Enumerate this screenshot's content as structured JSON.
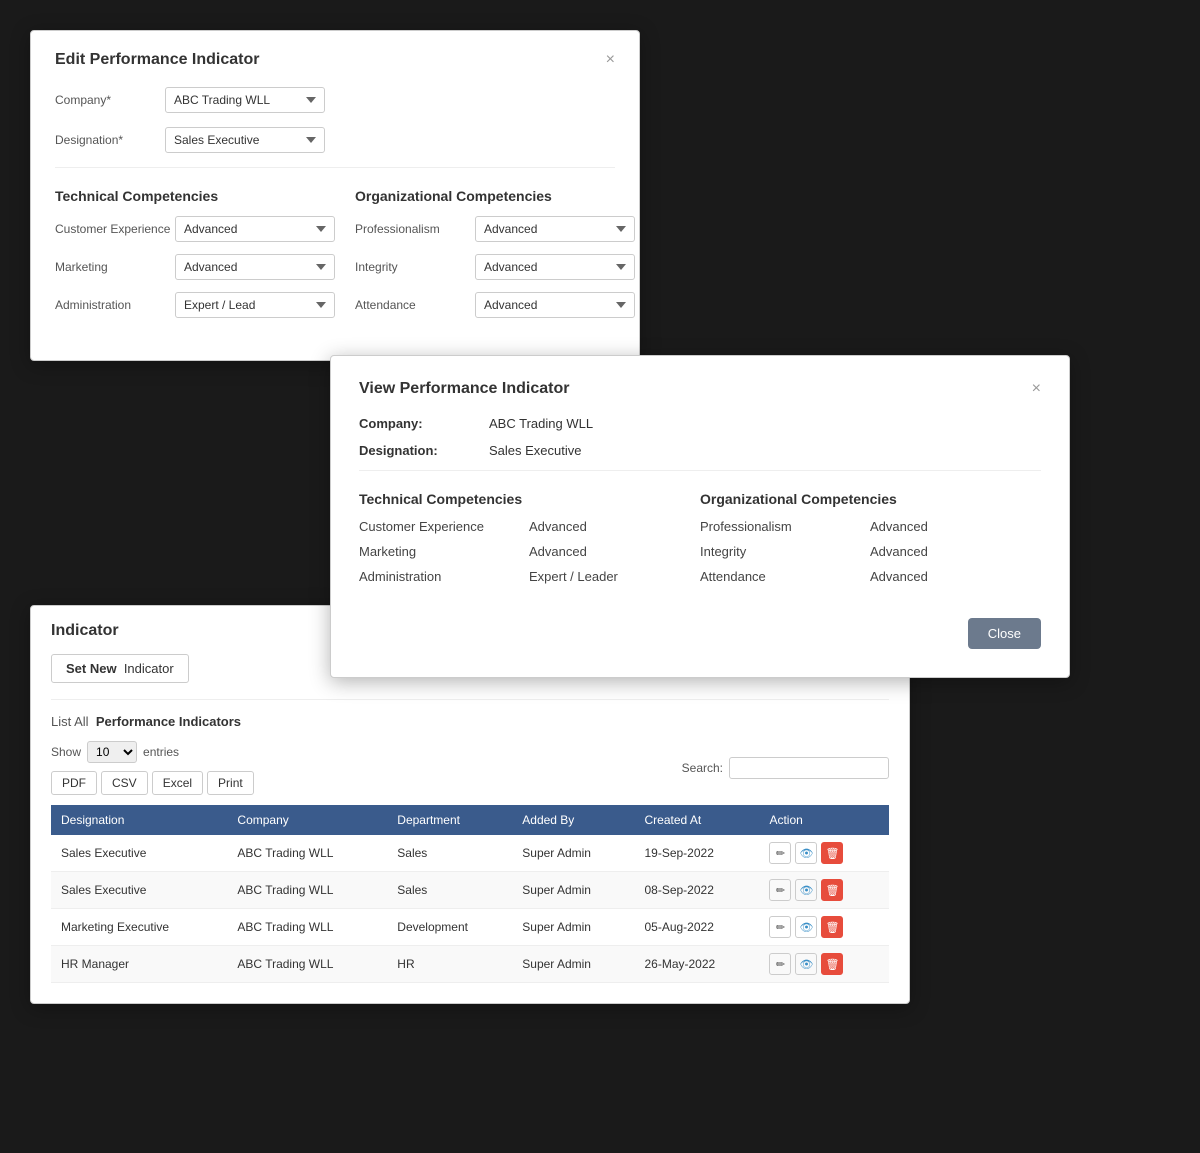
{
  "editModal": {
    "title": "Edit Performance Indicator",
    "close_label": "×",
    "company_label": "Company*",
    "company_value": "ABC Trading WLL",
    "designation_label": "Designation*",
    "designation_value": "Sales Executive",
    "technical_title": "Technical Competencies",
    "organizational_title": "Organizational Competencies",
    "technical_rows": [
      {
        "label": "Customer Experience",
        "value": "Advanced"
      },
      {
        "label": "Marketing",
        "value": "Advanced"
      },
      {
        "label": "Administration",
        "value": "Expert / Lead"
      }
    ],
    "organizational_rows": [
      {
        "label": "Professionalism",
        "value": "Advanced"
      },
      {
        "label": "Integrity",
        "value": "Advanced"
      },
      {
        "label": "Attendance",
        "value": "Advanced"
      }
    ]
  },
  "viewModal": {
    "title": "View Performance Indicator",
    "close_label": "×",
    "company_label": "Company:",
    "company_value": "ABC Trading WLL",
    "designation_label": "Designation:",
    "designation_value": "Sales Executive",
    "technical_title": "Technical Competencies",
    "organizational_title": "Organizational Competencies",
    "technical_rows": [
      {
        "label": "Customer Experience",
        "value": "Advanced"
      },
      {
        "label": "Marketing",
        "value": "Advanced"
      },
      {
        "label": "Administration",
        "value": "Expert / Leader"
      }
    ],
    "organizational_rows": [
      {
        "label": "Professionalism",
        "value": "Advanced"
      },
      {
        "label": "Integrity",
        "value": "Advanced"
      },
      {
        "label": "Attendance",
        "value": "Advanced"
      }
    ],
    "close_button": "Close"
  },
  "indicatorPanel": {
    "title": "Indicator",
    "set_new_label": "Set New",
    "set_new_suffix": "Indicator",
    "list_prefix": "List All",
    "list_main": "Performance Indicators",
    "show_label": "Show",
    "entries_value": "10",
    "entries_label": "entries",
    "export_buttons": [
      "PDF",
      "CSV",
      "Excel",
      "Print"
    ],
    "search_label": "Search:",
    "search_placeholder": "",
    "table_headers": [
      "Designation",
      "Company",
      "Department",
      "Added By",
      "Created At",
      "Action"
    ],
    "table_rows": [
      {
        "designation": "Sales Executive",
        "company": "ABC Trading WLL",
        "department": "Sales",
        "added_by": "Super Admin",
        "created_at": "19-Sep-2022"
      },
      {
        "designation": "Sales Executive",
        "company": "ABC Trading WLL",
        "department": "Sales",
        "added_by": "Super Admin",
        "created_at": "08-Sep-2022"
      },
      {
        "designation": "Marketing Executive",
        "company": "ABC Trading WLL",
        "department": "Development",
        "added_by": "Super Admin",
        "created_at": "05-Aug-2022"
      },
      {
        "designation": "HR Manager",
        "company": "ABC Trading WLL",
        "department": "HR",
        "added_by": "Super Admin",
        "created_at": "26-May-2022"
      }
    ]
  }
}
